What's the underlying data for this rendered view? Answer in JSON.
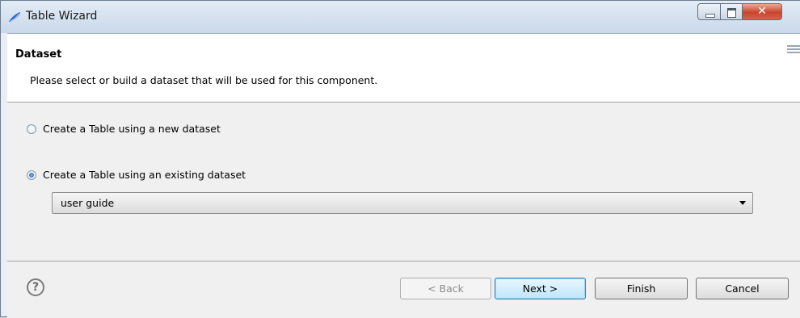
{
  "window": {
    "title": "Table Wizard",
    "icon": "eclipse-birt-icon",
    "controls": {
      "minimize": "minimize-icon",
      "maximize": "maximize-icon",
      "close": "✕"
    }
  },
  "header": {
    "title": "Dataset",
    "description": "Please select or build a dataset that will be used for this component."
  },
  "options": [
    {
      "label": "Create a Table using a new dataset",
      "selected": false
    },
    {
      "label": "Create a Table using an existing dataset",
      "selected": true
    }
  ],
  "dataset_select": {
    "value": "user guide"
  },
  "footer": {
    "help": "?",
    "back": "< Back",
    "next": "Next >",
    "finish": "Finish",
    "cancel": "Cancel"
  },
  "colors": {
    "default_button_border": "#3c7fb1",
    "close_button": "#c9452e"
  }
}
